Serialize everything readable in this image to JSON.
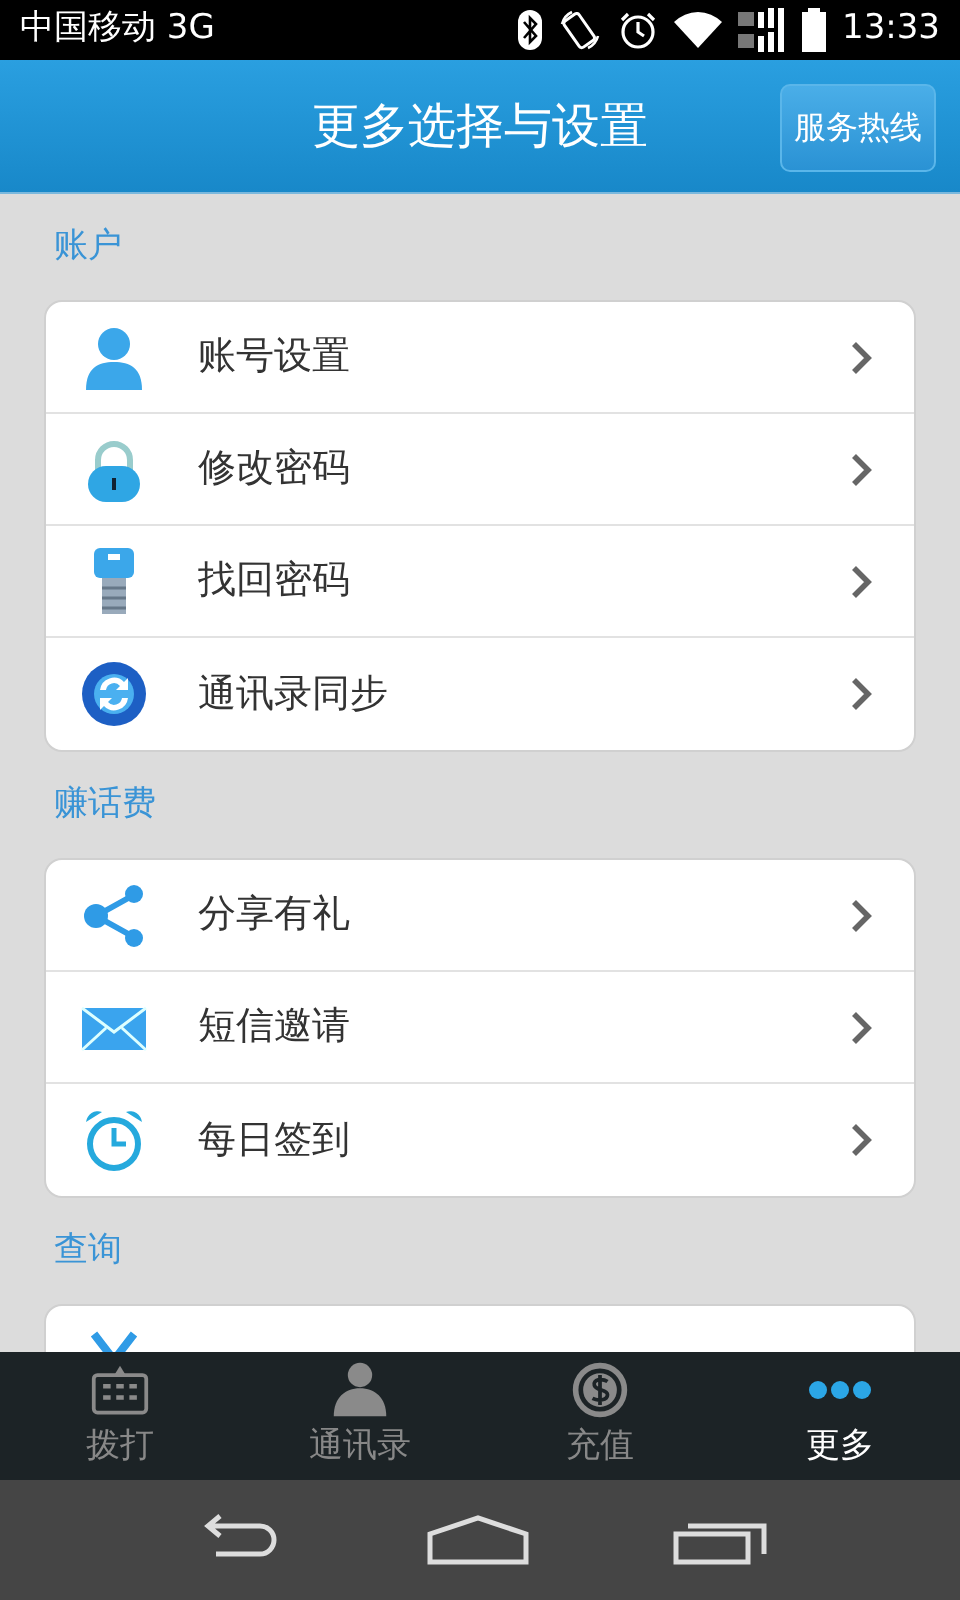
{
  "status_bar": {
    "carrier": "中国移动 3G",
    "time": "13:33"
  },
  "header": {
    "title": "更多选择与设置",
    "hotline_button": "服务热线"
  },
  "sections": [
    {
      "title": "账户",
      "items": [
        {
          "kind": "entry",
          "label": "账号设置"
        },
        {
          "kind": "entry",
          "label": "修改密码"
        },
        {
          "kind": "entry",
          "label": "找回密码"
        },
        {
          "kind": "entry",
          "label": "通讯录同步"
        }
      ]
    },
    {
      "title": "赚话费",
      "items": [
        {
          "kind": "entry",
          "label": "分享有礼"
        },
        {
          "kind": "entry",
          "label": "短信邀请"
        },
        {
          "kind": "entry",
          "label": "每日签到"
        }
      ]
    },
    {
      "title": "查询",
      "items": [
        {
          "kind": "cut-off"
        }
      ]
    }
  ],
  "tabs": [
    {
      "label": "拨打",
      "selected": false
    },
    {
      "label": "通讯录",
      "selected": false
    },
    {
      "label": "充值",
      "selected": false
    },
    {
      "label": "更多",
      "selected": true
    }
  ]
}
